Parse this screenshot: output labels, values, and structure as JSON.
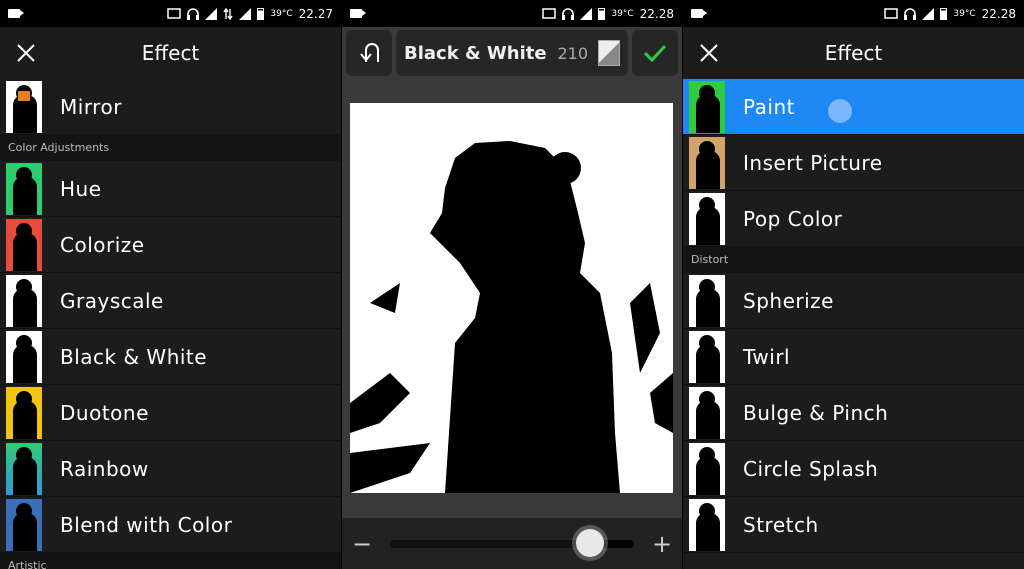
{
  "status_left": {
    "time": "22.27",
    "temp": "39°C"
  },
  "status_mid": {
    "time": "22.28",
    "temp": "39°C"
  },
  "status_right": {
    "time": "22.28",
    "temp": "39°C"
  },
  "left_panel": {
    "title": "Effect",
    "top_item": "Mirror",
    "section": "Color Adjustments",
    "items": [
      "Hue",
      "Colorize",
      "Grayscale",
      "Black & White",
      "Duotone",
      "Rainbow",
      "Blend with Color"
    ],
    "next_section": "Artistic"
  },
  "editor": {
    "title": "Black & White",
    "value": "210",
    "slider_value": 0.82,
    "minus": "−",
    "plus": "+"
  },
  "right_panel": {
    "title": "Effect",
    "items_top": [
      "Paint",
      "Insert Picture",
      "Pop Color"
    ],
    "section": "Distort",
    "items": [
      "Spherize",
      "Twirl",
      "Bulge & Pinch",
      "Circle Splash",
      "Stretch"
    ]
  },
  "colors": {
    "selected": "#1e88f5",
    "check": "#2ecc40"
  }
}
